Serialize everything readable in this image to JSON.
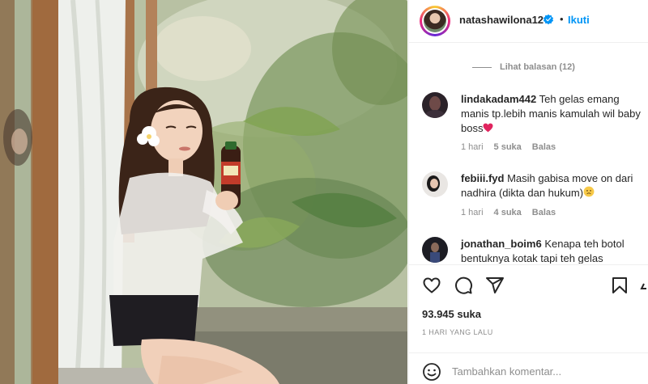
{
  "header": {
    "username": "natashawilona12",
    "dot": "•",
    "follow_label": "Ikuti"
  },
  "comments": {
    "view_replies": "Lihat balasan (12)",
    "items": [
      {
        "username": "lindakadam442",
        "text": "Teh gelas emang manis tp.lebih manis kamulah wil baby boss",
        "emoji": "red-heart-icon",
        "time": "1 hari",
        "likes": "5 suka",
        "reply": "Balas"
      },
      {
        "username": "febiii.fyd",
        "text": "Masih gabisa move on dari nadhira (dikta dan hukum)",
        "emoji": "sad-face-icon",
        "time": "1 hari",
        "likes": "4 suka",
        "reply": "Balas"
      },
      {
        "username": "jonathan_boim6",
        "text": "Kenapa teh botol bentuknya kotak tapi teh gelas",
        "emoji": "",
        "time": "",
        "likes": "",
        "reply": ""
      }
    ]
  },
  "actions": {
    "icons": [
      "heart-icon",
      "comment-icon",
      "share-icon",
      "bookmark-icon"
    ]
  },
  "likes_count": "93.945 suka",
  "time_ago": "1 HARI YANG LALU",
  "add_comment": {
    "placeholder": "Tambahkan komentar..."
  },
  "colors": {
    "accent": "#0095f6",
    "text": "#262626",
    "muted": "#8e8e8e",
    "border": "#efefef"
  }
}
